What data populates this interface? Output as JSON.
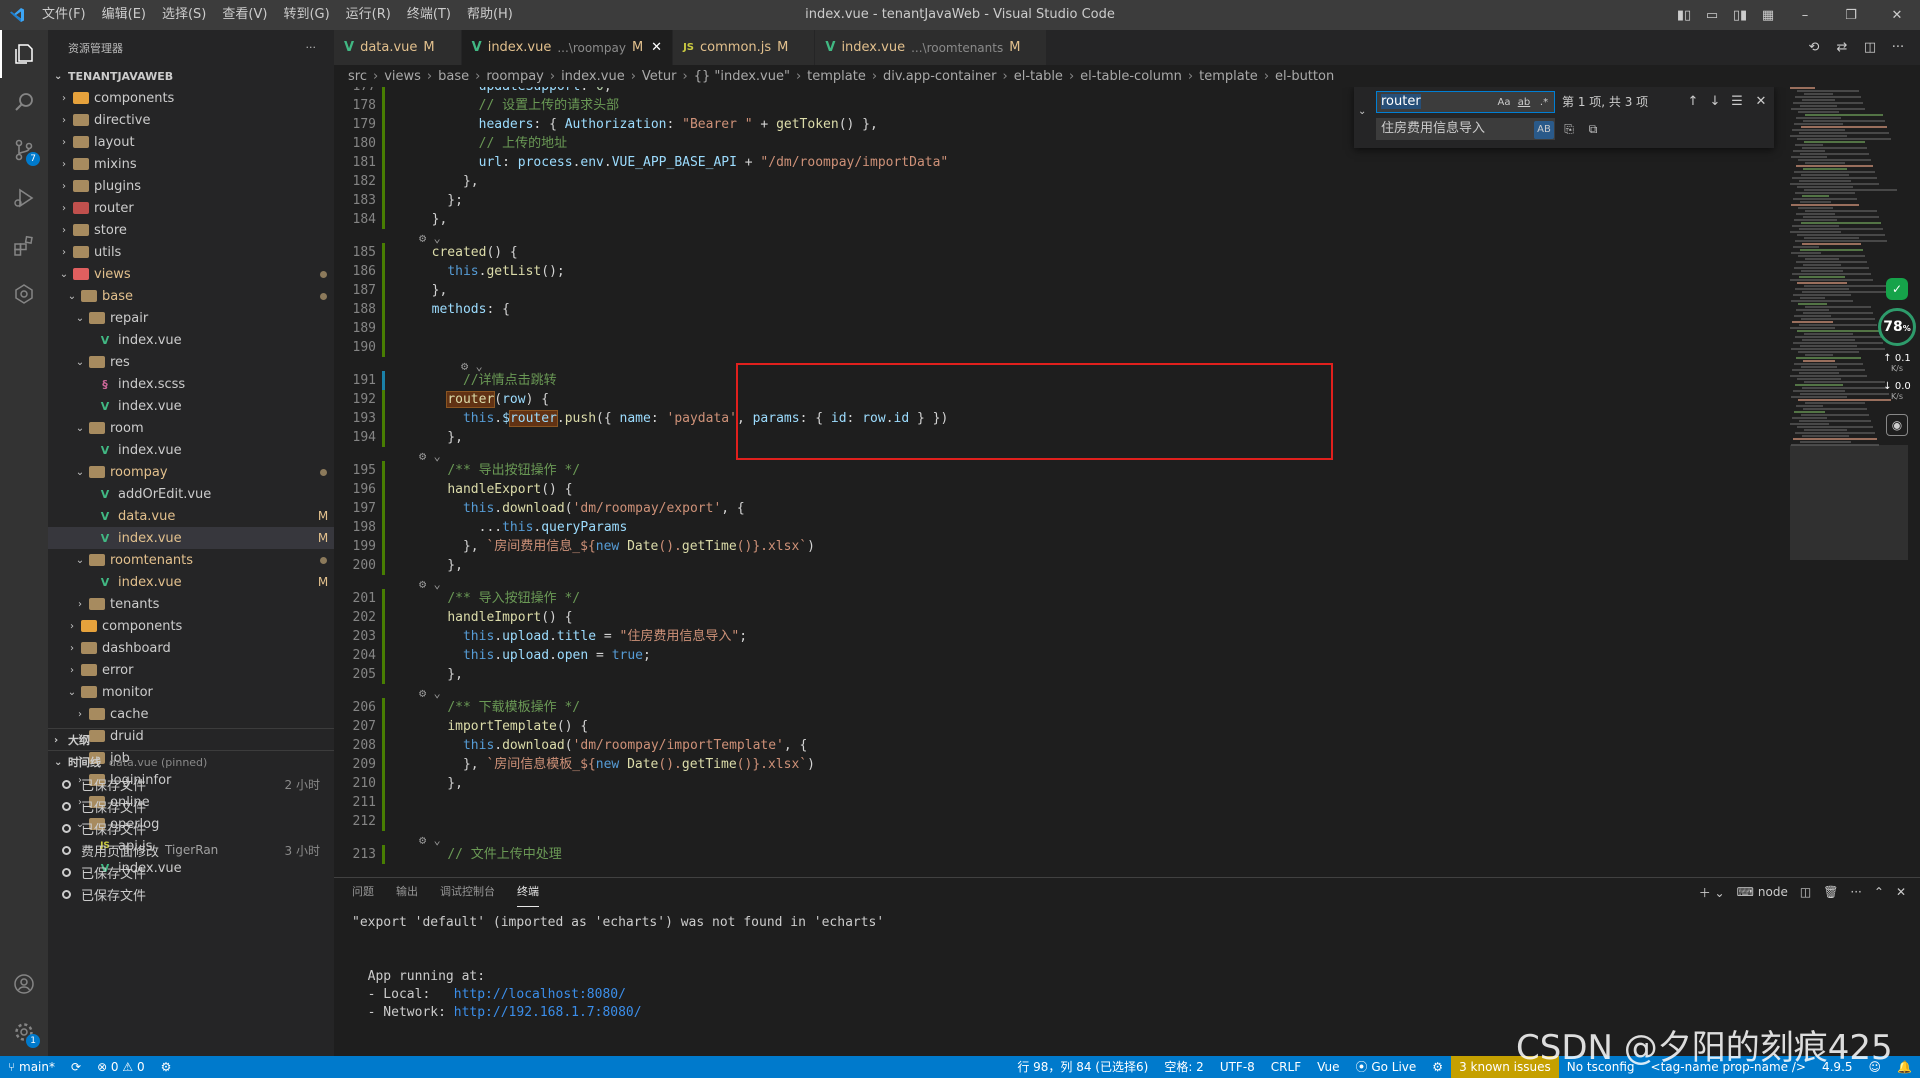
{
  "titlebar": {
    "menu": [
      "文件(F)",
      "编辑(E)",
      "选择(S)",
      "查看(V)",
      "转到(G)",
      "运行(R)",
      "终端(T)",
      "帮助(H)"
    ],
    "title": "index.vue - tenantJavaWeb - Visual Studio Code",
    "minimize": "–",
    "restore": "❐",
    "close": "✕"
  },
  "sidebar": {
    "header": "资源管理器",
    "more": "···",
    "project": "TENANTJAVAWEB",
    "tree": [
      {
        "label": "components",
        "depth": 1,
        "type": "folder",
        "color": "#e6a23c",
        "expanded": false
      },
      {
        "label": "directive",
        "depth": 1,
        "type": "folder",
        "color": "#a78b5f",
        "expanded": false
      },
      {
        "label": "layout",
        "depth": 1,
        "type": "folder",
        "color": "#a78b5f",
        "expanded": false
      },
      {
        "label": "mixins",
        "depth": 1,
        "type": "folder",
        "color": "#a78b5f",
        "expanded": false
      },
      {
        "label": "plugins",
        "depth": 1,
        "type": "folder",
        "color": "#a78b5f",
        "expanded": false
      },
      {
        "label": "router",
        "depth": 1,
        "type": "folder",
        "color": "#c0504d",
        "expanded": false
      },
      {
        "label": "store",
        "depth": 1,
        "type": "folder",
        "color": "#a78b5f",
        "expanded": false
      },
      {
        "label": "utils",
        "depth": 1,
        "type": "folder",
        "color": "#a78b5f",
        "expanded": false
      },
      {
        "label": "views",
        "depth": 1,
        "type": "folder",
        "color": "#e05f5f",
        "expanded": true,
        "status": "dot",
        "mod": true
      },
      {
        "label": "base",
        "depth": 2,
        "type": "folder",
        "color": "#a78b5f",
        "expanded": true,
        "status": "dot",
        "mod": true
      },
      {
        "label": "repair",
        "depth": 3,
        "type": "folder",
        "color": "#a78b5f",
        "expanded": true
      },
      {
        "label": "index.vue",
        "depth": 4,
        "type": "vue"
      },
      {
        "label": "res",
        "depth": 3,
        "type": "folder",
        "color": "#a78b5f",
        "expanded": true
      },
      {
        "label": "index.scss",
        "depth": 4,
        "type": "scss"
      },
      {
        "label": "index.vue",
        "depth": 4,
        "type": "vue"
      },
      {
        "label": "room",
        "depth": 3,
        "type": "folder",
        "color": "#a78b5f",
        "expanded": true
      },
      {
        "label": "index.vue",
        "depth": 4,
        "type": "vue"
      },
      {
        "label": "roompay",
        "depth": 3,
        "type": "folder",
        "color": "#a78b5f",
        "expanded": true,
        "status": "dot",
        "mod": true
      },
      {
        "label": "addOrEdit.vue",
        "depth": 4,
        "type": "vue"
      },
      {
        "label": "data.vue",
        "depth": 4,
        "type": "vue",
        "status": "M",
        "mod": true
      },
      {
        "label": "index.vue",
        "depth": 4,
        "type": "vue",
        "status": "M",
        "mod": true,
        "selected": true
      },
      {
        "label": "roomtenants",
        "depth": 3,
        "type": "folder",
        "color": "#a78b5f",
        "expanded": true,
        "status": "dot",
        "mod": true
      },
      {
        "label": "index.vue",
        "depth": 4,
        "type": "vue",
        "status": "M",
        "mod": true
      },
      {
        "label": "tenants",
        "depth": 3,
        "type": "folder",
        "color": "#a78b5f",
        "expanded": false
      },
      {
        "label": "components",
        "depth": 2,
        "type": "folder",
        "color": "#e6a23c",
        "expanded": false
      },
      {
        "label": "dashboard",
        "depth": 2,
        "type": "folder",
        "color": "#a78b5f",
        "expanded": false
      },
      {
        "label": "error",
        "depth": 2,
        "type": "folder",
        "color": "#a78b5f",
        "expanded": false
      },
      {
        "label": "monitor",
        "depth": 2,
        "type": "folder",
        "color": "#a78b5f",
        "expanded": true
      },
      {
        "label": "cache",
        "depth": 3,
        "type": "folder",
        "color": "#a78b5f",
        "expanded": false
      },
      {
        "label": "druid",
        "depth": 3,
        "type": "folder",
        "color": "#a78b5f",
        "expanded": false
      },
      {
        "label": "job",
        "depth": 3,
        "type": "folder",
        "color": "#a78b5f",
        "expanded": false
      },
      {
        "label": "logininfor",
        "depth": 3,
        "type": "folder",
        "color": "#a78b5f",
        "expanded": false
      },
      {
        "label": "online",
        "depth": 3,
        "type": "folder",
        "color": "#a78b5f",
        "expanded": false
      },
      {
        "label": "operlog",
        "depth": 3,
        "type": "folder",
        "color": "#a78b5f",
        "expanded": true
      },
      {
        "label": "api.js",
        "depth": 4,
        "type": "js"
      },
      {
        "label": "index.vue",
        "depth": 4,
        "type": "vue"
      }
    ],
    "outline": "大纲",
    "timeline": {
      "title": "时间线",
      "pinned": "data.vue (pinned)",
      "items": [
        {
          "label": "已保存文件",
          "time": "2 小时"
        },
        {
          "label": "已保存文件",
          "time": ""
        },
        {
          "label": "已保存文件",
          "time": ""
        },
        {
          "label": "费用页面修改",
          "author": "TigerRan",
          "time": "3 小时"
        },
        {
          "label": "已保存文件",
          "time": ""
        },
        {
          "label": "已保存文件",
          "time": ""
        }
      ]
    }
  },
  "tabs": [
    {
      "icon": "V",
      "label": "data.vue",
      "desc": "",
      "status": "M",
      "active": false
    },
    {
      "icon": "V",
      "label": "index.vue",
      "desc": "...\\roompay",
      "status": "M",
      "active": true,
      "close": "✕"
    },
    {
      "icon": "JS",
      "label": "common.js",
      "desc": "",
      "status": "M",
      "active": false
    },
    {
      "icon": "V",
      "label": "index.vue",
      "desc": "...\\roomtenants",
      "status": "M",
      "active": false
    }
  ],
  "breadcrumb": [
    "src",
    "views",
    "base",
    "roompay",
    "index.vue",
    "Vetur",
    "{} \"index.vue\"",
    "template",
    "div.app-container",
    "el-table",
    "el-table-column",
    "template",
    "el-button"
  ],
  "editor": {
    "lines": [
      {
        "n": "177",
        "gut": "add",
        "html": "      <span class='prop'>updateSupport</span>: <span class='num'>0</span>,"
      },
      {
        "n": "178",
        "gut": "add",
        "html": "      <span class='cm'>// 设置上传的请求头部</span>"
      },
      {
        "n": "179",
        "gut": "add",
        "html": "      <span class='prop'>headers</span>: { <span class='prop'>Authorization</span>: <span class='str'>\"Bearer \"</span> + <span class='fn'>getToken</span>() },"
      },
      {
        "n": "180",
        "gut": "add",
        "html": "      <span class='cm'>// 上传的地址</span>"
      },
      {
        "n": "181",
        "gut": "add",
        "html": "      <span class='prop'>url</span>: <span class='prop'>process</span>.<span class='prop'>env</span>.<span class='prop'>VUE_APP_BASE_API</span> + <span class='str'>\"/dm/roompay/importData\"</span>"
      },
      {
        "n": "182",
        "gut": "add",
        "html": "    },"
      },
      {
        "n": "183",
        "gut": "add",
        "html": "  };"
      },
      {
        "n": "184",
        "gut": "add",
        "html": "},"
      },
      {
        "n": "185",
        "gut": "add",
        "html": "<span class='fn'>created</span>() {",
        "lens": true
      },
      {
        "n": "186",
        "gut": "add",
        "html": "  <span class='kw'>this</span>.<span class='fn'>getList</span>();"
      },
      {
        "n": "187",
        "gut": "add",
        "html": "},"
      },
      {
        "n": "188",
        "gut": "add",
        "html": "<span class='prop'>methods</span>: {"
      },
      {
        "n": "189",
        "gut": "add",
        "html": ""
      },
      {
        "n": "190",
        "gut": "add",
        "html": ""
      },
      {
        "n": "191",
        "gut": "mod",
        "html": "    <span class='cm'>//详情点击跳转</span>",
        "lens": true
      },
      {
        "n": "192",
        "gut": "add",
        "html": "  <span class='fn hl'>router</span>(<span class='prop'>row</span>) {"
      },
      {
        "n": "193",
        "gut": "add",
        "html": "    <span class='kw'>this</span>.<span class='prop'>$<span class='hl'>router</span></span>.<span class='fn'>push</span>({ <span class='prop'>name</span>: <span class='str'>'paydata'</span>, <span class='prop'>params</span>: { <span class='prop'>id</span>: <span class='prop'>row</span>.<span class='prop'>id</span> } })"
      },
      {
        "n": "194",
        "gut": "add",
        "html": "  },"
      },
      {
        "n": "195",
        "gut": "add",
        "html": "  <span class='cm'>/** 导出按钮操作 */</span>",
        "lens": true
      },
      {
        "n": "196",
        "gut": "add",
        "html": "  <span class='fn'>handleExport</span>() {"
      },
      {
        "n": "197",
        "gut": "add",
        "html": "    <span class='kw'>this</span>.<span class='fn'>download</span>(<span class='str'>'dm/roompay/export'</span>, {"
      },
      {
        "n": "198",
        "gut": "add",
        "html": "      ...<span class='kw'>this</span>.<span class='prop'>queryParams</span>"
      },
      {
        "n": "199",
        "gut": "add",
        "html": "    }, <span class='tmpl'>`房间费用信息_${<span class='kw'>new</span> <span class='fn'>Date</span>().<span class='fn'>getTime</span>()}.xlsx`</span>)"
      },
      {
        "n": "200",
        "gut": "add",
        "html": "  },"
      },
      {
        "n": "201",
        "gut": "add",
        "html": "  <span class='cm'>/** 导入按钮操作 */</span>",
        "lens": true
      },
      {
        "n": "202",
        "gut": "add",
        "html": "  <span class='fn'>handleImport</span>() {"
      },
      {
        "n": "203",
        "gut": "add",
        "html": "    <span class='kw'>this</span>.<span class='prop'>upload</span>.<span class='prop'>title</span> = <span class='str'>\"住房费用信息导入\"</span>;"
      },
      {
        "n": "204",
        "gut": "add",
        "html": "    <span class='kw'>this</span>.<span class='prop'>upload</span>.<span class='prop'>open</span> = <span class='kw'>true</span>;"
      },
      {
        "n": "205",
        "gut": "add",
        "html": "  },"
      },
      {
        "n": "206",
        "gut": "add",
        "html": "  <span class='cm'>/** 下载模板操作 */</span>",
        "lens": true
      },
      {
        "n": "207",
        "gut": "add",
        "html": "  <span class='fn'>importTemplate</span>() {"
      },
      {
        "n": "208",
        "gut": "add",
        "html": "    <span class='kw'>this</span>.<span class='fn'>download</span>(<span class='str'>'dm/roompay/importTemplate'</span>, {"
      },
      {
        "n": "209",
        "gut": "add",
        "html": "    }, <span class='tmpl'>`房间信息模板_${<span class='kw'>new</span> <span class='fn'>Date</span>().<span class='fn'>getTime</span>()}.xlsx`</span>)"
      },
      {
        "n": "210",
        "gut": "add",
        "html": "  },"
      },
      {
        "n": "211",
        "gut": "add",
        "html": ""
      },
      {
        "n": "212",
        "gut": "add",
        "html": ""
      },
      {
        "n": "213",
        "gut": "add",
        "html": "  <span class='cm'>// 文件上传中处理</span>",
        "lens": true
      }
    ],
    "lens_glyph": "⚙ ⌄"
  },
  "find": {
    "toggle": "⌄",
    "query": "router",
    "match_case": "Aa",
    "whole_word": "ab",
    "regex": ".*",
    "count": "第 1 项, 共 3 项",
    "prev": "↑",
    "next": "↓",
    "in_selection": "☰",
    "close": "✕",
    "replace": "住房费用信息导入",
    "preserve_case": "AB",
    "replace_one": "⎘",
    "replace_all": "⧉"
  },
  "netwidget": {
    "percent": "78",
    "percent_unit": "%",
    "up": "0.1",
    "down": "0.0",
    "unit": "K/s"
  },
  "panel": {
    "tabs": [
      "问题",
      "输出",
      "调试控制台",
      "终端"
    ],
    "active_tab": "终端",
    "shell": "node",
    "terminal": {
      "line1": "\"export 'default' (imported as 'echarts') was not found in 'echarts'",
      "line2": "  App running at:",
      "local_label": "  - Local:   ",
      "local_url": "http://localhost:8080/",
      "network_label": "  - Network: ",
      "network_url": "http://192.168.1.7:8080/"
    }
  },
  "statusbar": {
    "branch": "main*",
    "sync": "⟳",
    "problems": "⊗ 0 ⚠ 0",
    "position": "行 98，列 84 (已选择6)",
    "spaces": "空格: 2",
    "encoding": "UTF-8",
    "eol": "CRLF",
    "language": "Vue",
    "golive": "Go Live",
    "issues": "3 known issues",
    "tsconfig": "No tsconfig",
    "tagname": "<tag-name prop-name />",
    "version": "4.9.5"
  },
  "watermark": "CSDN @夕阳的刻痕425"
}
